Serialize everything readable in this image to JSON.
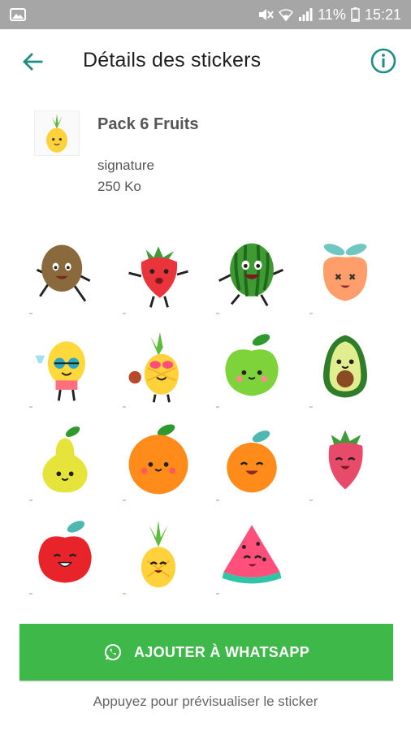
{
  "status_bar": {
    "battery": "11%",
    "time": "15:21",
    "icons": [
      "image-notification-icon",
      "mute-icon",
      "wifi-icon",
      "signal-icon",
      "battery-icon"
    ]
  },
  "app_bar": {
    "title": "Détails des stickers",
    "back_icon": "arrow-left-icon",
    "info_icon": "info-icon",
    "accent": "#1e8e82"
  },
  "pack": {
    "name": "Pack 6 Fruits",
    "author": "signature",
    "size": "250 Ko",
    "tray_icon": "pineapple-icon"
  },
  "stickers": [
    {
      "name": "kiwi"
    },
    {
      "name": "strawberry"
    },
    {
      "name": "watermelon"
    },
    {
      "name": "peach"
    },
    {
      "name": "lemon"
    },
    {
      "name": "pineapple"
    },
    {
      "name": "green-apple"
    },
    {
      "name": "avocado"
    },
    {
      "name": "pear"
    },
    {
      "name": "orange"
    },
    {
      "name": "tangerine"
    },
    {
      "name": "strawberry"
    },
    {
      "name": "red-apple"
    },
    {
      "name": "pineapple"
    },
    {
      "name": "watermelon-slice"
    }
  ],
  "add_button": {
    "label": "AJOUTER À WHATSAPP",
    "icon": "whatsapp-icon",
    "color": "#3fb84a"
  },
  "hint": "Appuyez pour prévisualiser le sticker"
}
